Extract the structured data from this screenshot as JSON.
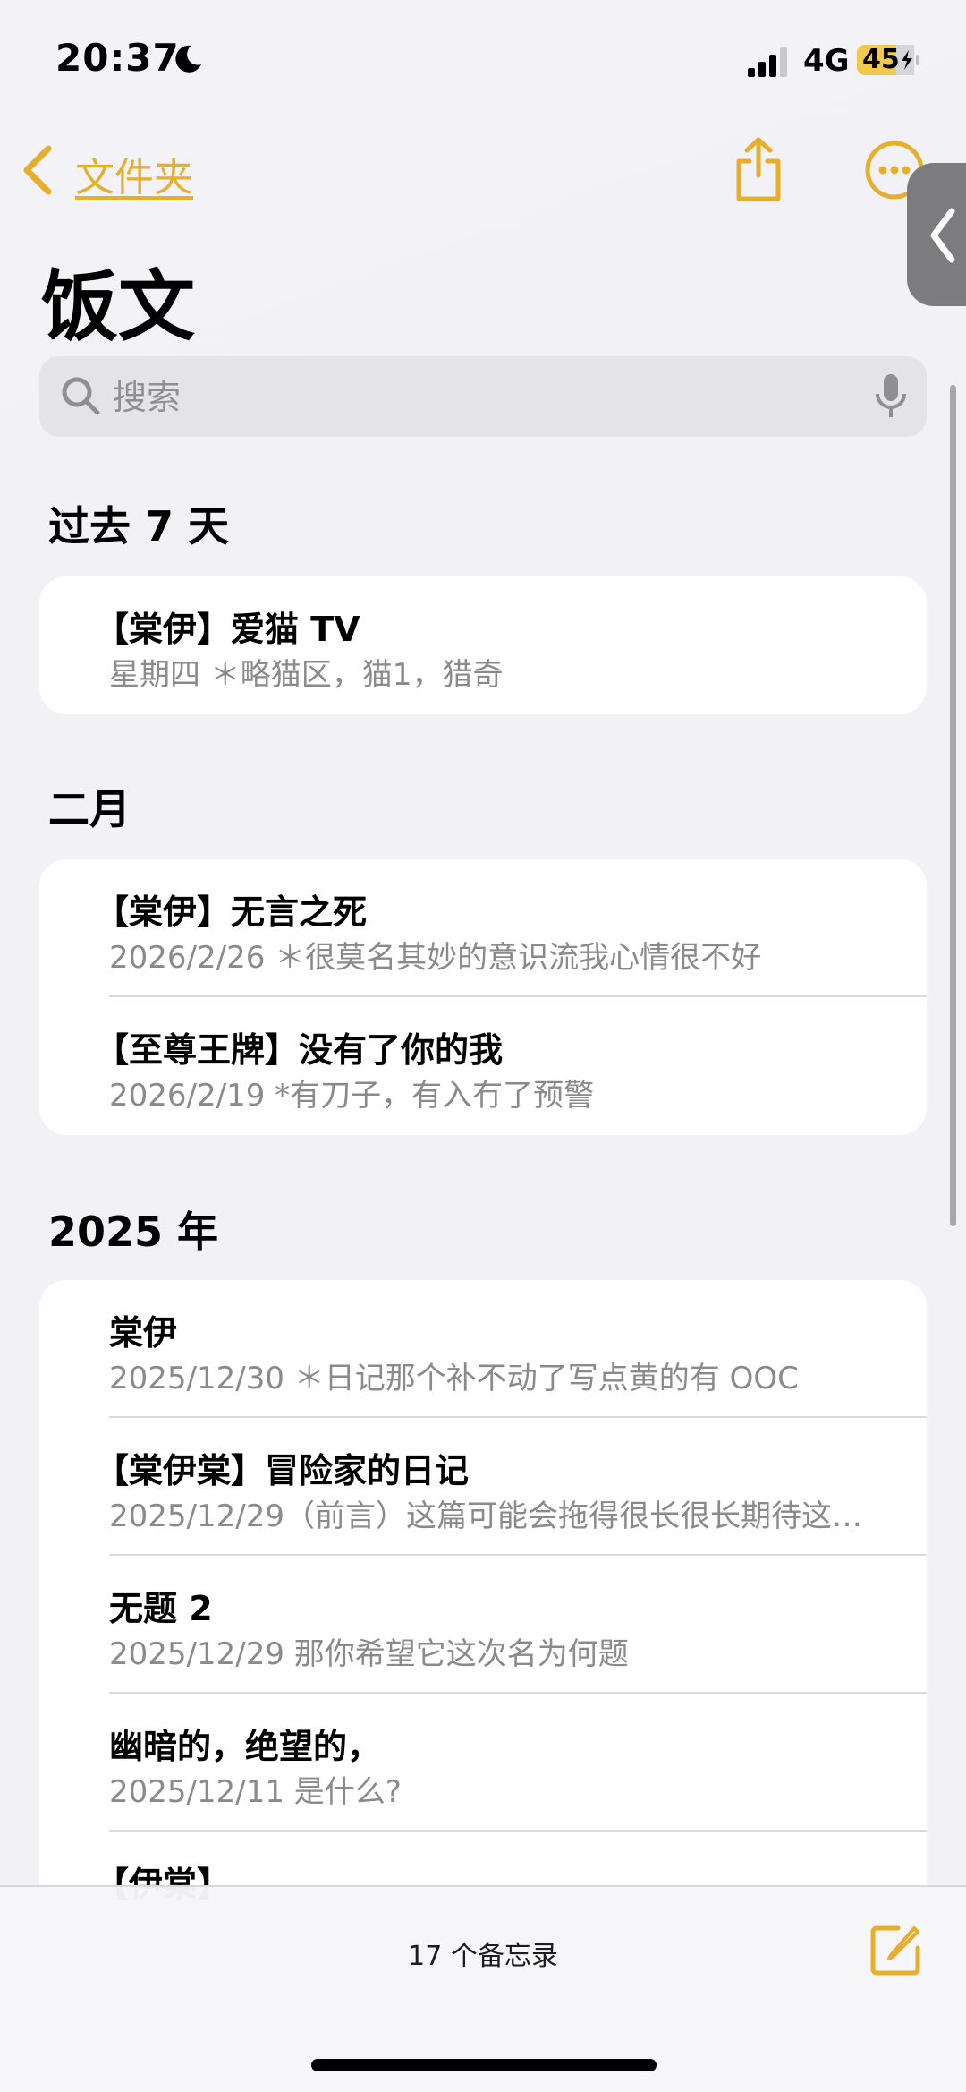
{
  "status_bar": {
    "time": "20:37",
    "network": "4G",
    "battery": "45"
  },
  "nav": {
    "back_label": "文件夹"
  },
  "page_title": "饭文",
  "search": {
    "placeholder": "搜索"
  },
  "sections": [
    {
      "title": "过去 7 天",
      "notes": [
        {
          "title": "【棠伊】爱猫 TV",
          "detail": "星期四 ＊略猫区，猫1，猎奇"
        }
      ]
    },
    {
      "title": "二月",
      "notes": [
        {
          "title": "【棠伊】无言之死",
          "detail": "2026/2/26 ＊很莫名其妙的意识流我心情很不好"
        },
        {
          "title": "【至尊王牌】没有了你的我",
          "detail": "2026/2/19 *有刀子，有入冇了预警"
        }
      ]
    },
    {
      "title": "2025 年",
      "notes": [
        {
          "title": "棠伊",
          "detail": "2025/12/30 ＊日记那个补不动了写点黄的有 OOC"
        },
        {
          "title": "【棠伊棠】冒险家的日记",
          "detail": "2025/12/29（前言）这篇可能会拖得很长很长期待这…"
        },
        {
          "title": "无题 2",
          "detail": "2025/12/29 那你希望它这次名为何题"
        },
        {
          "title": "幽暗的，绝望的，",
          "detail": "2025/12/11 是什么?"
        },
        {
          "title": "【伊棠】",
          "detail": ""
        }
      ]
    }
  ],
  "toolbar": {
    "count_label": "17 个备忘录"
  },
  "colors": {
    "accent": "#E5AF2C",
    "background": "#F2F2F7",
    "card": "#FFFFFF",
    "secondary_text": "#8A8A8E"
  }
}
